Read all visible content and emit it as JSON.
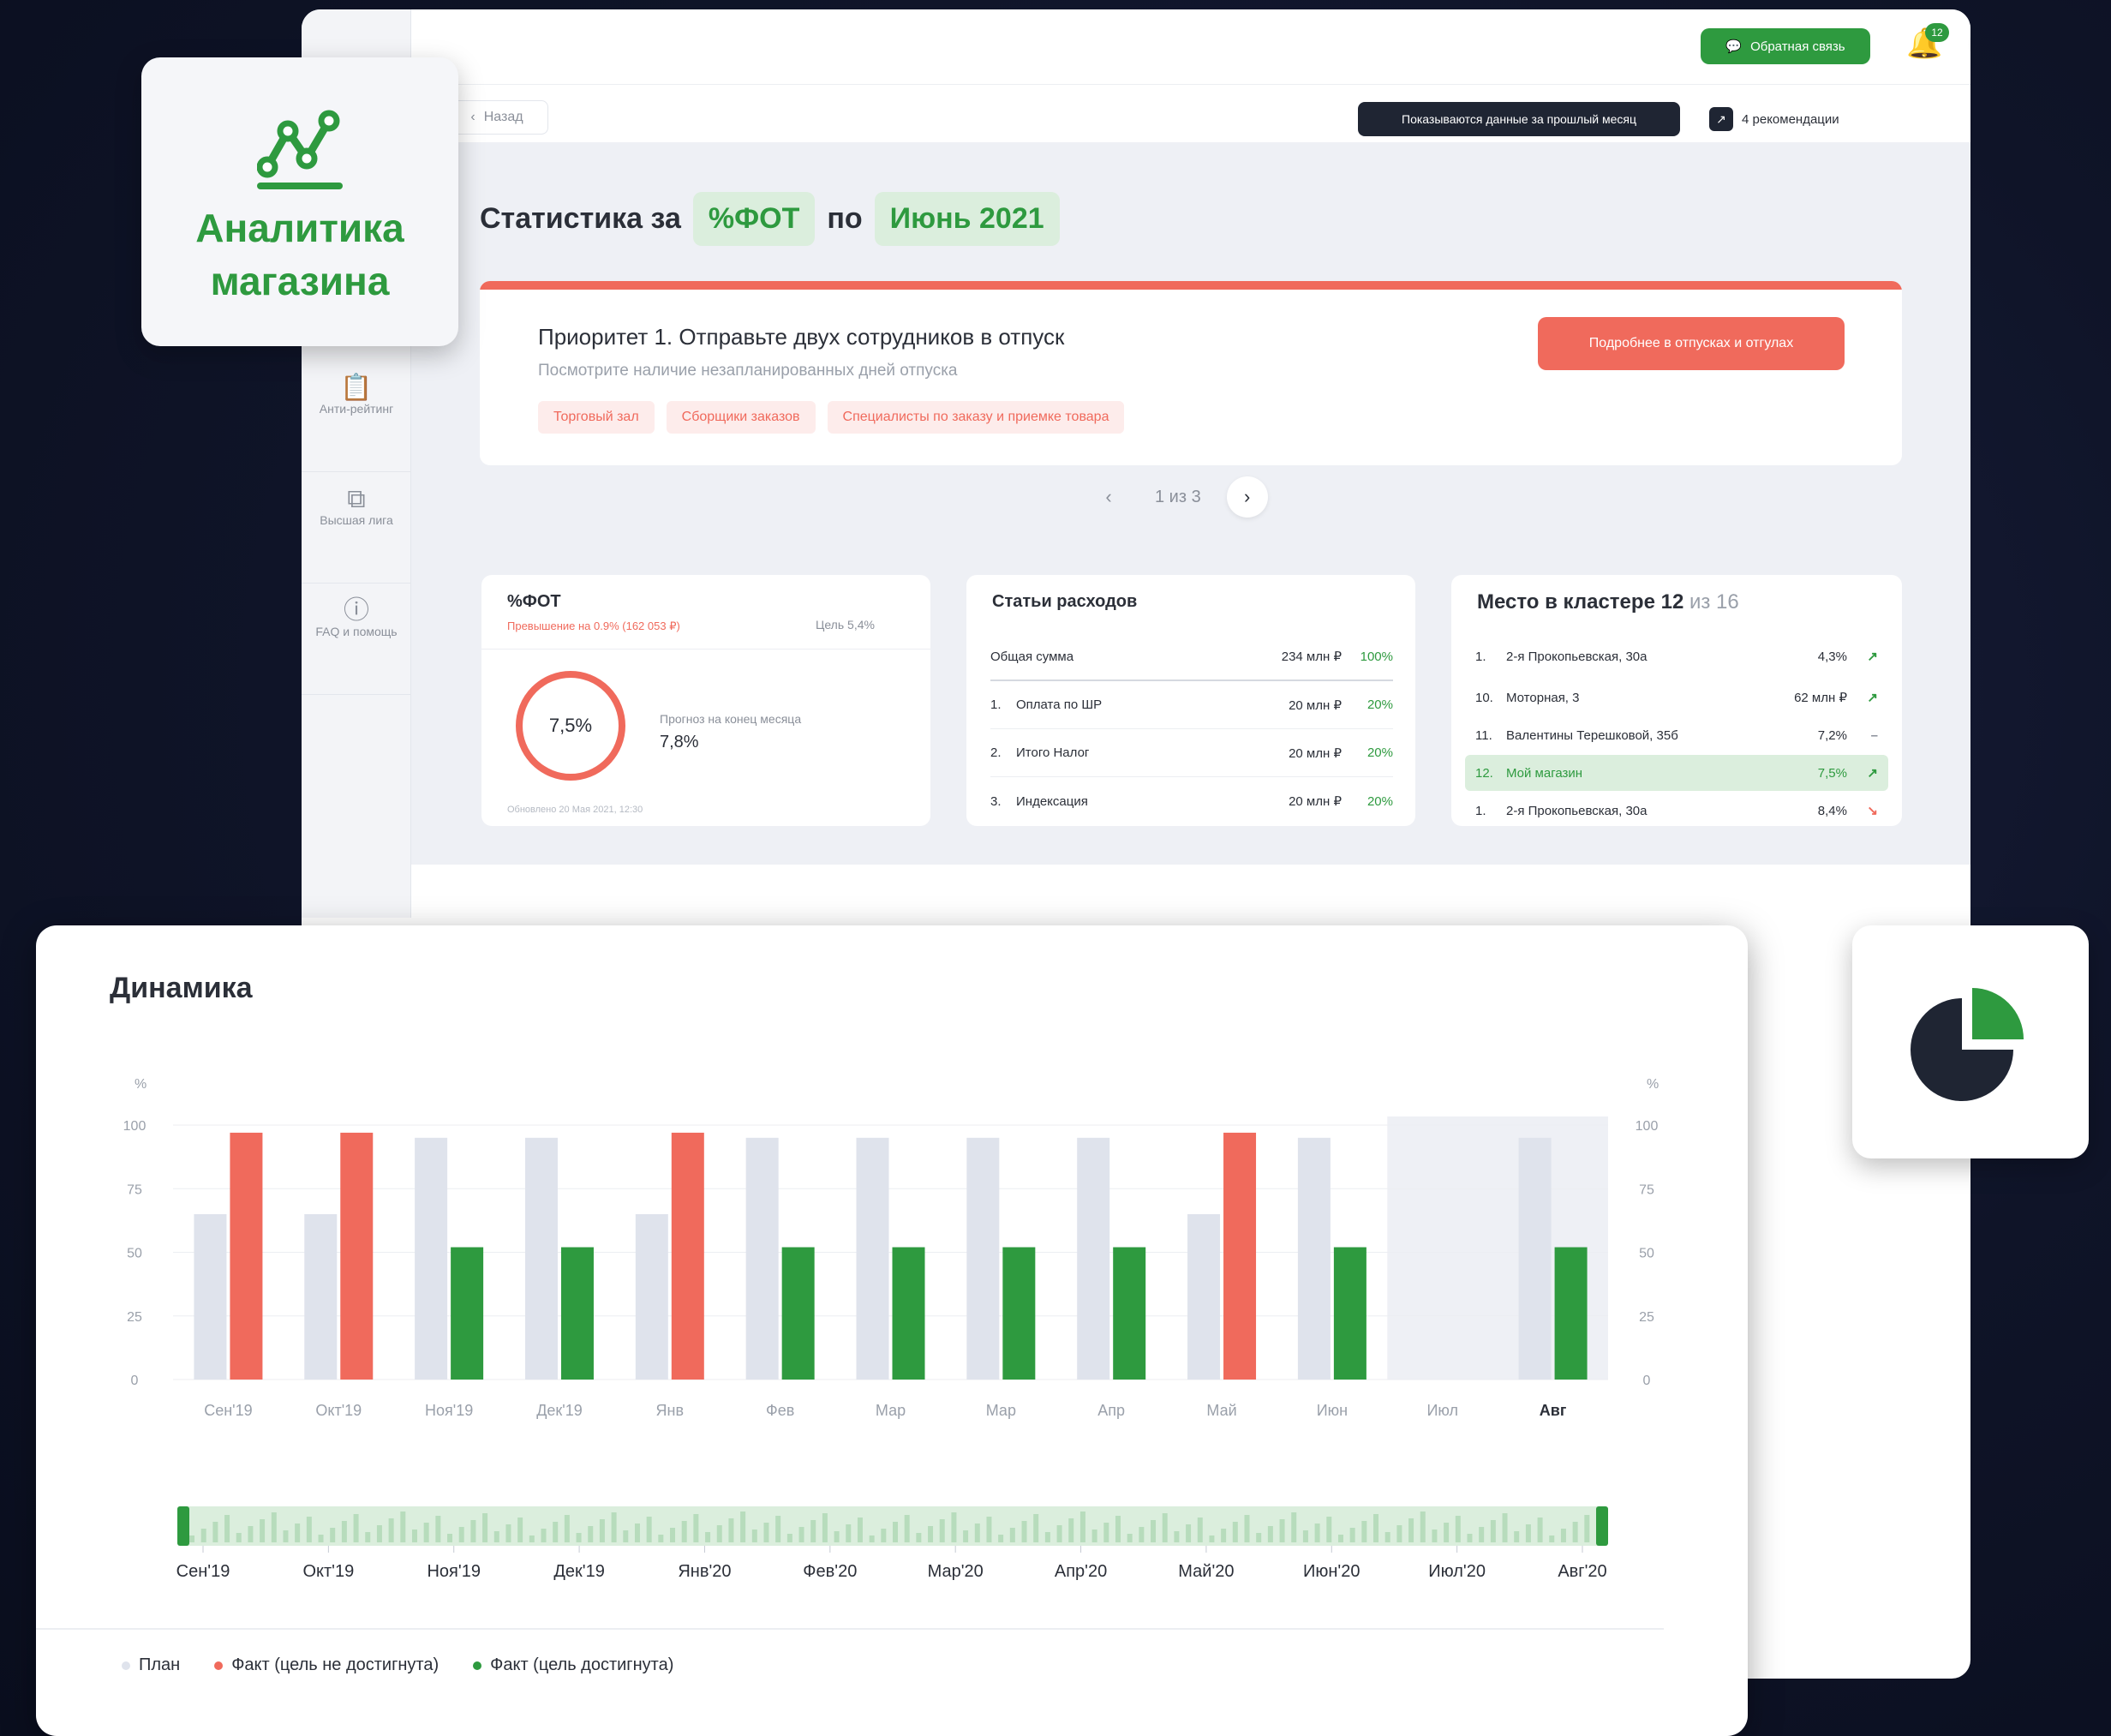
{
  "logo": {
    "line1": "Аналитика",
    "line2": "магазина"
  },
  "sidebar": {
    "items": [
      {
        "label": "Анти-рейтинг",
        "icon": "clipboard-icon"
      },
      {
        "label": "Высшая лига",
        "icon": "copy-icon"
      },
      {
        "label": "FAQ и помощь",
        "icon": "help-icon"
      }
    ]
  },
  "topbar": {
    "feedback_label": "Обратная связь",
    "notifications_badge": "12"
  },
  "subbar": {
    "back_label": "Назад",
    "info_chip": "Показываются данные за прошлый месяц",
    "recommendations_label": "4 рекомендации"
  },
  "header": {
    "prefix": "Статистика за",
    "metric": "%ФОТ",
    "middle": "по",
    "period": "Июнь 2021"
  },
  "priority": {
    "title": "Приоритет 1. Отправьте двух сотрудников в отпуск",
    "subtitle": "Посмотрите наличие незапланированных дней отпуска",
    "tags": [
      "Торговый зал",
      "Сборщики заказов",
      "Специалисты по заказу и приемке товара"
    ],
    "button_label": "Подробнее в отпусках и отгулах"
  },
  "pager": {
    "text": "1 из 3"
  },
  "fot": {
    "title": "%ФОТ",
    "warning": "Превышение на 0.9% (162 053 ₽)",
    "target": "Цель 5,4%",
    "value": "7,5%",
    "forecast_label": "Прогноз на конец месяца",
    "forecast_value": "7,8%",
    "updated": "Обновлено 20 Мая 2021, 12:30"
  },
  "costs": {
    "title": "Статьи расходов",
    "rows": [
      {
        "n": "",
        "label": "Общая сумма",
        "value": "234 млн ₽",
        "pct": "100%"
      },
      {
        "n": "1.",
        "label": "Оплата по ШР",
        "value": "20 млн ₽",
        "pct": "20%"
      },
      {
        "n": "2.",
        "label": "Итого Налог",
        "value": "20 млн ₽",
        "pct": "20%"
      },
      {
        "n": "3.",
        "label": "Индексация",
        "value": "20 млн ₽",
        "pct": "20%"
      }
    ]
  },
  "cluster": {
    "title": "Место в кластере",
    "place": "12",
    "of_label": "из 16",
    "rows": [
      {
        "n": "1.",
        "label": "2-я Прокопьевская, 30а",
        "value": "4,3%",
        "arrow": "↗"
      },
      {
        "n": "10.",
        "label": "Моторная, 3",
        "value": "62 млн ₽",
        "arrow": "↗"
      },
      {
        "n": "11.",
        "label": "Валентины Терешковой, 35б",
        "value": "7,2%",
        "arrow": "–"
      },
      {
        "n": "12.",
        "label": "Мой магазин",
        "value": "7,5%",
        "arrow": "↗"
      },
      {
        "n": "1.",
        "label": "2-я Прокопьевская, 30а",
        "value": "8,4%",
        "arrow": "↘"
      }
    ]
  },
  "dynamics": {
    "title": "Динамика",
    "navigator_labels": [
      "Сен'19",
      "Окт'19",
      "Ноя'19",
      "Дек'19",
      "Янв'20",
      "Фев'20",
      "Мар'20",
      "Апр'20",
      "Май'20",
      "Июн'20",
      "Июл'20",
      "Авг'20"
    ],
    "legend": [
      {
        "label": "План",
        "color": "#dfe3ec"
      },
      {
        "label": "Факт (цель не достигнута)",
        "color": "#f06a5c"
      },
      {
        "label": "Факт (цель достигнута)",
        "color": "#2e9a3f"
      }
    ]
  },
  "chart_data": {
    "type": "bar",
    "categories": [
      "Сен'19",
      "Окт'19",
      "Ноя'19",
      "Дек'19",
      "Янв",
      "Фев",
      "Мар",
      "Мар",
      "Апр",
      "Май",
      "Июн",
      "Июл",
      "Авг"
    ],
    "series": [
      {
        "name": "План",
        "values": [
          65,
          65,
          95,
          95,
          65,
          95,
          95,
          95,
          95,
          65,
          95,
          null,
          95
        ]
      },
      {
        "name": "Факт (цель не достигнута)",
        "values": [
          97,
          97,
          null,
          null,
          97,
          null,
          null,
          null,
          null,
          97,
          null,
          null,
          null
        ]
      },
      {
        "name": "Факт (цель достигнута)",
        "values": [
          null,
          null,
          52,
          52,
          null,
          52,
          52,
          52,
          52,
          null,
          52,
          null,
          52
        ]
      }
    ],
    "ylabel": "%",
    "y_ticks": [
      0,
      25,
      50,
      75,
      100
    ],
    "ylim": [
      0,
      100
    ],
    "colors": {
      "plan": "#dfe3ec",
      "missed": "#f06a5c",
      "achieved": "#2e9a3f"
    }
  }
}
